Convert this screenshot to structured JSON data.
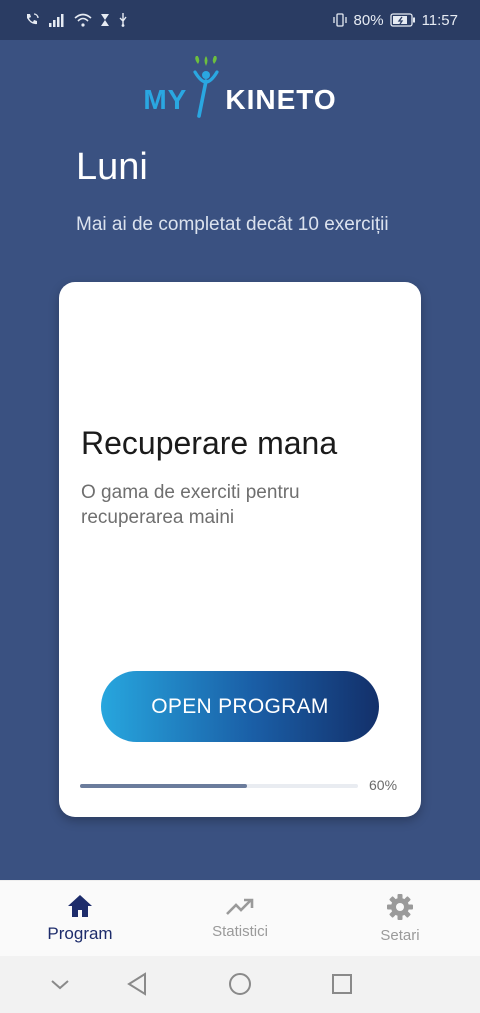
{
  "status_bar": {
    "battery": "80%",
    "time": "11:57"
  },
  "logo": {
    "part1": "MY",
    "part2": "KINETO"
  },
  "day": "Luni",
  "subtitle": "Mai ai de completat decât 10 exerciții",
  "card": {
    "title": "Recuperare mana",
    "description": "O gama de exerciti pentru recuperarea maini",
    "button_label": "OPEN PROGRAM",
    "progress_percent": 60,
    "progress_label": "60%"
  },
  "bottom_nav": {
    "items": [
      {
        "label": "Program",
        "icon": "home-icon",
        "active": true
      },
      {
        "label": "Statistici",
        "icon": "trending-up-icon",
        "active": false
      },
      {
        "label": "Setari",
        "icon": "gear-icon",
        "active": false
      }
    ]
  },
  "colors": {
    "background": "#3a5181",
    "status_bar": "#2a3c63",
    "accent_light": "#2aa7e1",
    "accent_dark": "#13306a",
    "nav_active": "#1d2c6b"
  }
}
